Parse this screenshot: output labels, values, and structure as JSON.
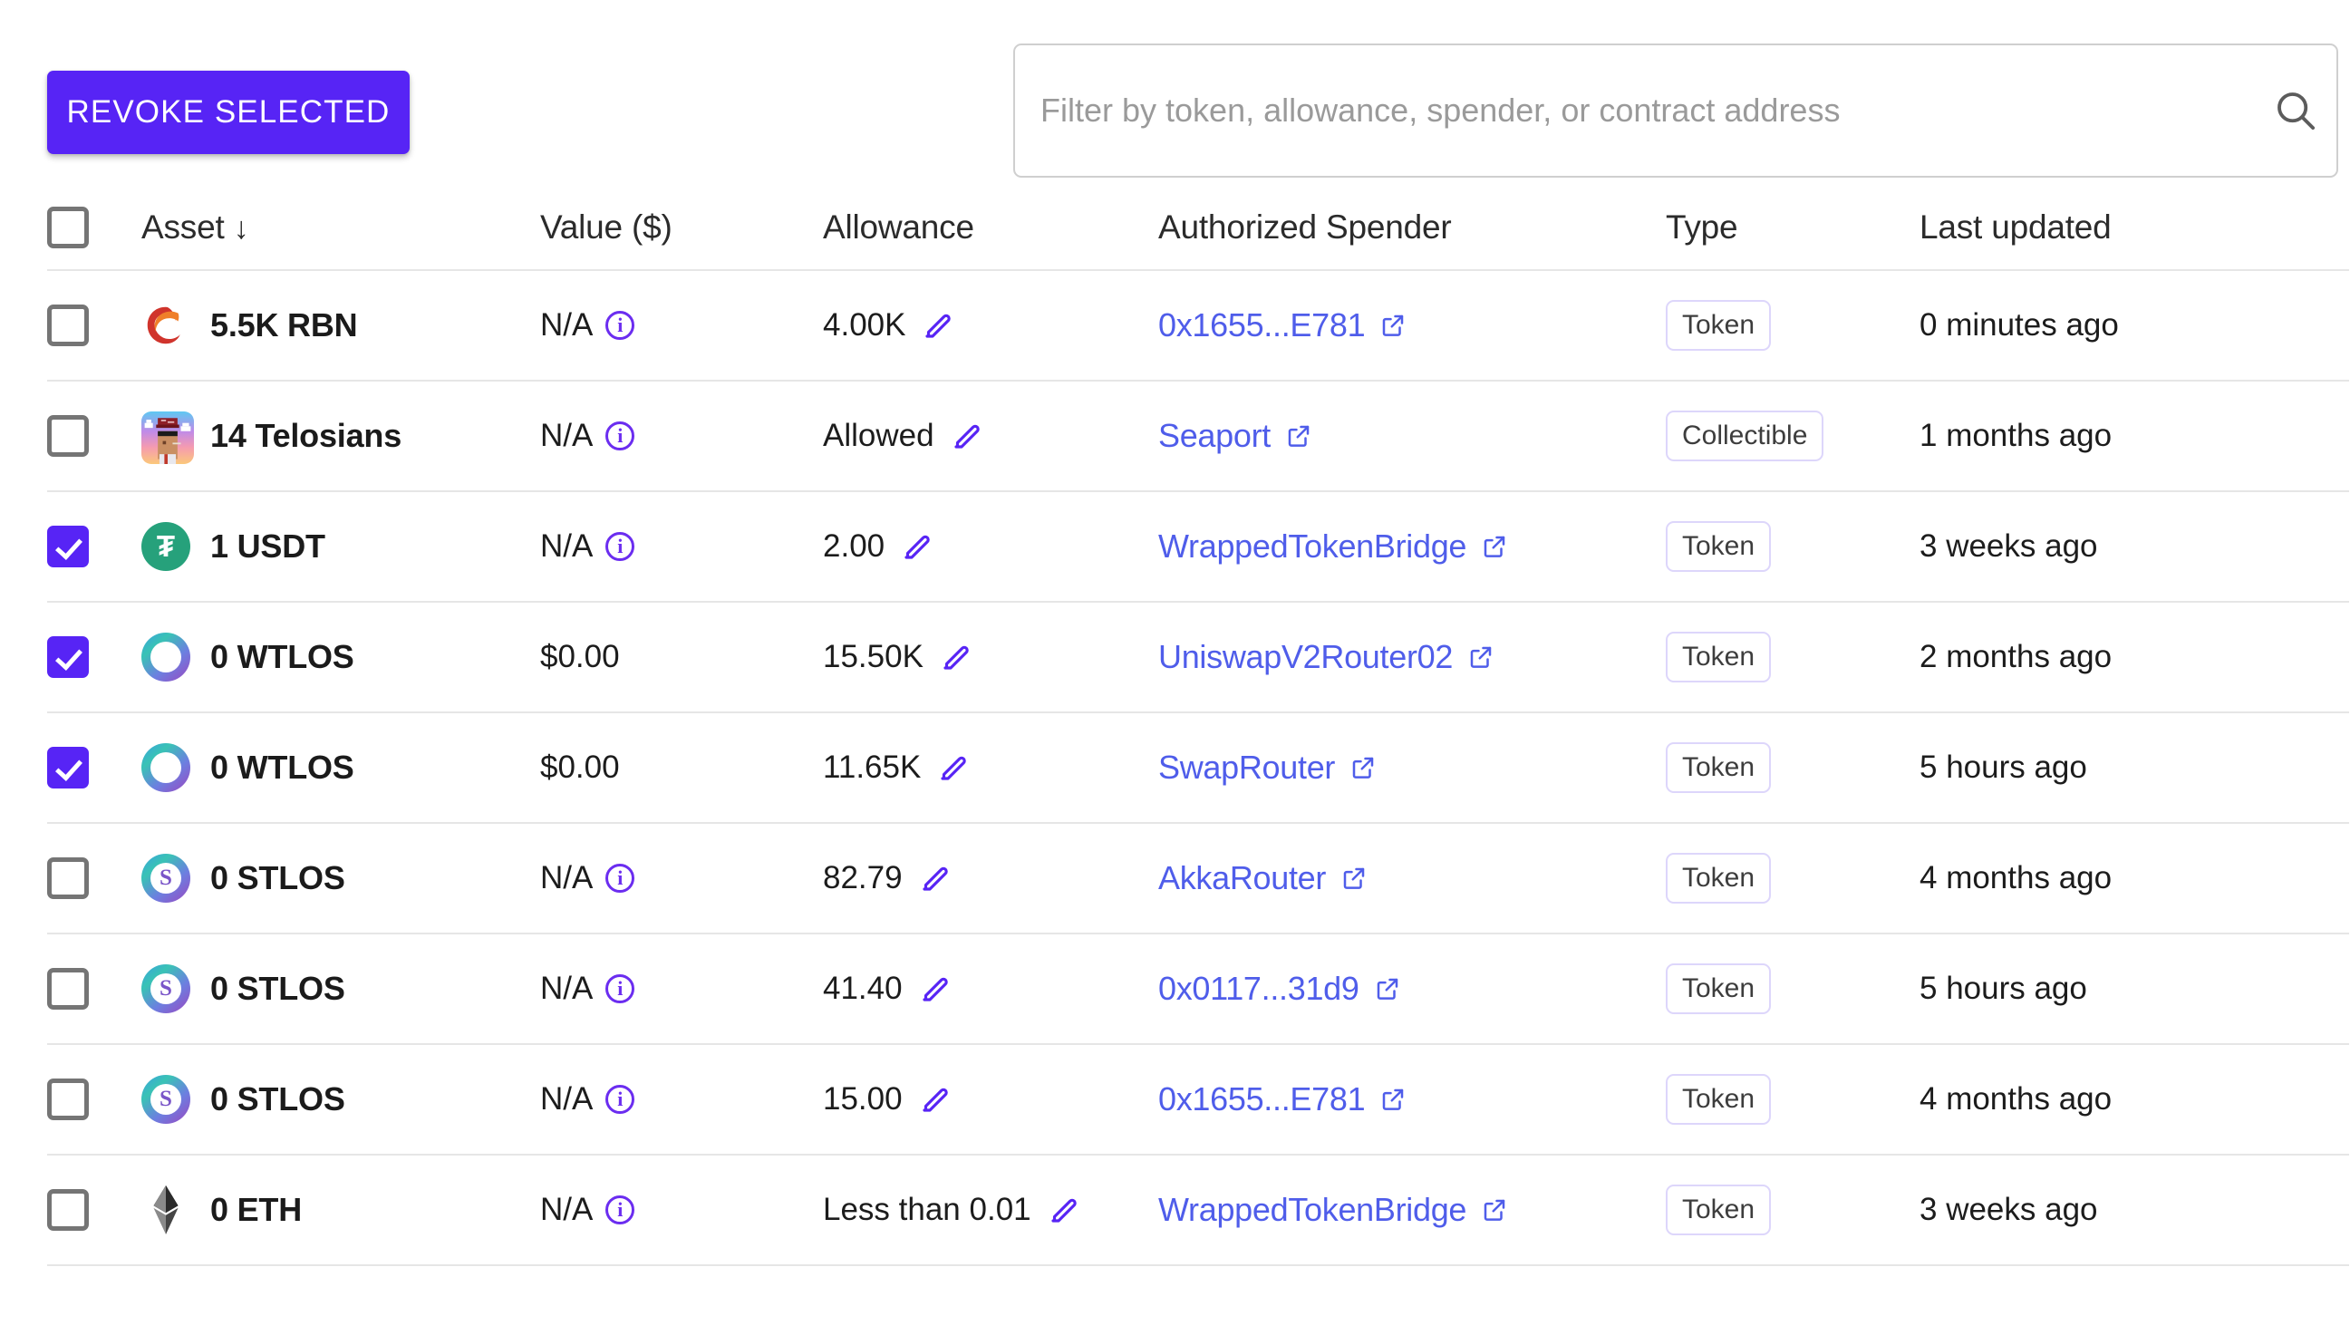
{
  "toolbar": {
    "revoke_label": "REVOKE SELECTED",
    "search_placeholder": "Filter by token, allowance, spender, or contract address",
    "search_value": "",
    "search_icon": "search-icon"
  },
  "colors": {
    "accent": "#5724f5",
    "link": "#4f5dea",
    "info": "#6b2df0",
    "badge_border": "#ddd6fb",
    "row_divider": "#e6e6e6"
  },
  "table": {
    "headers": {
      "select_all": "",
      "asset": "Asset",
      "asset_sort": "↓",
      "value": "Value ($)",
      "allowance": "Allowance",
      "spender": "Authorized Spender",
      "type": "Type",
      "updated": "Last updated"
    },
    "rows": [
      {
        "selected": false,
        "icon": "ribbon-phoenix-icon",
        "asset": "5.5K RBN",
        "value": "N/A",
        "value_has_info": true,
        "allowance": "4.00K",
        "spender": "0x1655...E781",
        "type": "Token",
        "updated": "0 minutes ago"
      },
      {
        "selected": false,
        "icon": "telosians-nft-icon",
        "asset": "14 Telosians",
        "value": "N/A",
        "value_has_info": true,
        "allowance": "Allowed",
        "spender": "Seaport",
        "type": "Collectible",
        "updated": "1 months ago"
      },
      {
        "selected": true,
        "icon": "usdt-icon",
        "asset": "1 USDT",
        "value": "N/A",
        "value_has_info": true,
        "allowance": "2.00",
        "spender": "WrappedTokenBridge",
        "type": "Token",
        "updated": "3 weeks ago"
      },
      {
        "selected": true,
        "icon": "wtlos-icon",
        "asset": "0 WTLOS",
        "value": "$0.00",
        "value_has_info": false,
        "allowance": "15.50K",
        "spender": "UniswapV2Router02",
        "type": "Token",
        "updated": "2 months ago"
      },
      {
        "selected": true,
        "icon": "wtlos-icon",
        "asset": "0 WTLOS",
        "value": "$0.00",
        "value_has_info": false,
        "allowance": "11.65K",
        "spender": "SwapRouter",
        "type": "Token",
        "updated": "5 hours ago"
      },
      {
        "selected": false,
        "icon": "stlos-icon",
        "asset": "0 STLOS",
        "value": "N/A",
        "value_has_info": true,
        "allowance": "82.79",
        "spender": "AkkaRouter",
        "type": "Token",
        "updated": "4 months ago"
      },
      {
        "selected": false,
        "icon": "stlos-icon",
        "asset": "0 STLOS",
        "value": "N/A",
        "value_has_info": true,
        "allowance": "41.40",
        "spender": "0x0117...31d9",
        "type": "Token",
        "updated": "5 hours ago"
      },
      {
        "selected": false,
        "icon": "stlos-icon",
        "asset": "0 STLOS",
        "value": "N/A",
        "value_has_info": true,
        "allowance": "15.00",
        "spender": "0x1655...E781",
        "type": "Token",
        "updated": "4 months ago"
      },
      {
        "selected": false,
        "icon": "ethereum-icon",
        "asset": "0 ETH",
        "value": "N/A",
        "value_has_info": true,
        "allowance": "Less than 0.01",
        "spender": "WrappedTokenBridge",
        "type": "Token",
        "updated": "3 weeks ago"
      }
    ]
  }
}
